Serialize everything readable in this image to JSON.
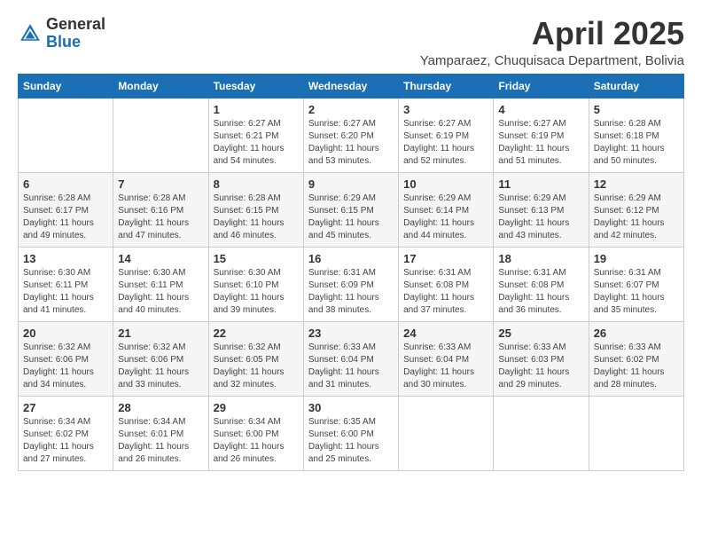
{
  "header": {
    "logo_general": "General",
    "logo_blue": "Blue",
    "month_title": "April 2025",
    "location": "Yamparaez, Chuquisaca Department, Bolivia"
  },
  "days_of_week": [
    "Sunday",
    "Monday",
    "Tuesday",
    "Wednesday",
    "Thursday",
    "Friday",
    "Saturday"
  ],
  "weeks": [
    [
      {
        "day": "",
        "info": ""
      },
      {
        "day": "",
        "info": ""
      },
      {
        "day": "1",
        "info": "Sunrise: 6:27 AM\nSunset: 6:21 PM\nDaylight: 11 hours and 54 minutes."
      },
      {
        "day": "2",
        "info": "Sunrise: 6:27 AM\nSunset: 6:20 PM\nDaylight: 11 hours and 53 minutes."
      },
      {
        "day": "3",
        "info": "Sunrise: 6:27 AM\nSunset: 6:19 PM\nDaylight: 11 hours and 52 minutes."
      },
      {
        "day": "4",
        "info": "Sunrise: 6:27 AM\nSunset: 6:19 PM\nDaylight: 11 hours and 51 minutes."
      },
      {
        "day": "5",
        "info": "Sunrise: 6:28 AM\nSunset: 6:18 PM\nDaylight: 11 hours and 50 minutes."
      }
    ],
    [
      {
        "day": "6",
        "info": "Sunrise: 6:28 AM\nSunset: 6:17 PM\nDaylight: 11 hours and 49 minutes."
      },
      {
        "day": "7",
        "info": "Sunrise: 6:28 AM\nSunset: 6:16 PM\nDaylight: 11 hours and 47 minutes."
      },
      {
        "day": "8",
        "info": "Sunrise: 6:28 AM\nSunset: 6:15 PM\nDaylight: 11 hours and 46 minutes."
      },
      {
        "day": "9",
        "info": "Sunrise: 6:29 AM\nSunset: 6:15 PM\nDaylight: 11 hours and 45 minutes."
      },
      {
        "day": "10",
        "info": "Sunrise: 6:29 AM\nSunset: 6:14 PM\nDaylight: 11 hours and 44 minutes."
      },
      {
        "day": "11",
        "info": "Sunrise: 6:29 AM\nSunset: 6:13 PM\nDaylight: 11 hours and 43 minutes."
      },
      {
        "day": "12",
        "info": "Sunrise: 6:29 AM\nSunset: 6:12 PM\nDaylight: 11 hours and 42 minutes."
      }
    ],
    [
      {
        "day": "13",
        "info": "Sunrise: 6:30 AM\nSunset: 6:11 PM\nDaylight: 11 hours and 41 minutes."
      },
      {
        "day": "14",
        "info": "Sunrise: 6:30 AM\nSunset: 6:11 PM\nDaylight: 11 hours and 40 minutes."
      },
      {
        "day": "15",
        "info": "Sunrise: 6:30 AM\nSunset: 6:10 PM\nDaylight: 11 hours and 39 minutes."
      },
      {
        "day": "16",
        "info": "Sunrise: 6:31 AM\nSunset: 6:09 PM\nDaylight: 11 hours and 38 minutes."
      },
      {
        "day": "17",
        "info": "Sunrise: 6:31 AM\nSunset: 6:08 PM\nDaylight: 11 hours and 37 minutes."
      },
      {
        "day": "18",
        "info": "Sunrise: 6:31 AM\nSunset: 6:08 PM\nDaylight: 11 hours and 36 minutes."
      },
      {
        "day": "19",
        "info": "Sunrise: 6:31 AM\nSunset: 6:07 PM\nDaylight: 11 hours and 35 minutes."
      }
    ],
    [
      {
        "day": "20",
        "info": "Sunrise: 6:32 AM\nSunset: 6:06 PM\nDaylight: 11 hours and 34 minutes."
      },
      {
        "day": "21",
        "info": "Sunrise: 6:32 AM\nSunset: 6:06 PM\nDaylight: 11 hours and 33 minutes."
      },
      {
        "day": "22",
        "info": "Sunrise: 6:32 AM\nSunset: 6:05 PM\nDaylight: 11 hours and 32 minutes."
      },
      {
        "day": "23",
        "info": "Sunrise: 6:33 AM\nSunset: 6:04 PM\nDaylight: 11 hours and 31 minutes."
      },
      {
        "day": "24",
        "info": "Sunrise: 6:33 AM\nSunset: 6:04 PM\nDaylight: 11 hours and 30 minutes."
      },
      {
        "day": "25",
        "info": "Sunrise: 6:33 AM\nSunset: 6:03 PM\nDaylight: 11 hours and 29 minutes."
      },
      {
        "day": "26",
        "info": "Sunrise: 6:33 AM\nSunset: 6:02 PM\nDaylight: 11 hours and 28 minutes."
      }
    ],
    [
      {
        "day": "27",
        "info": "Sunrise: 6:34 AM\nSunset: 6:02 PM\nDaylight: 11 hours and 27 minutes."
      },
      {
        "day": "28",
        "info": "Sunrise: 6:34 AM\nSunset: 6:01 PM\nDaylight: 11 hours and 26 minutes."
      },
      {
        "day": "29",
        "info": "Sunrise: 6:34 AM\nSunset: 6:00 PM\nDaylight: 11 hours and 26 minutes."
      },
      {
        "day": "30",
        "info": "Sunrise: 6:35 AM\nSunset: 6:00 PM\nDaylight: 11 hours and 25 minutes."
      },
      {
        "day": "",
        "info": ""
      },
      {
        "day": "",
        "info": ""
      },
      {
        "day": "",
        "info": ""
      }
    ]
  ]
}
